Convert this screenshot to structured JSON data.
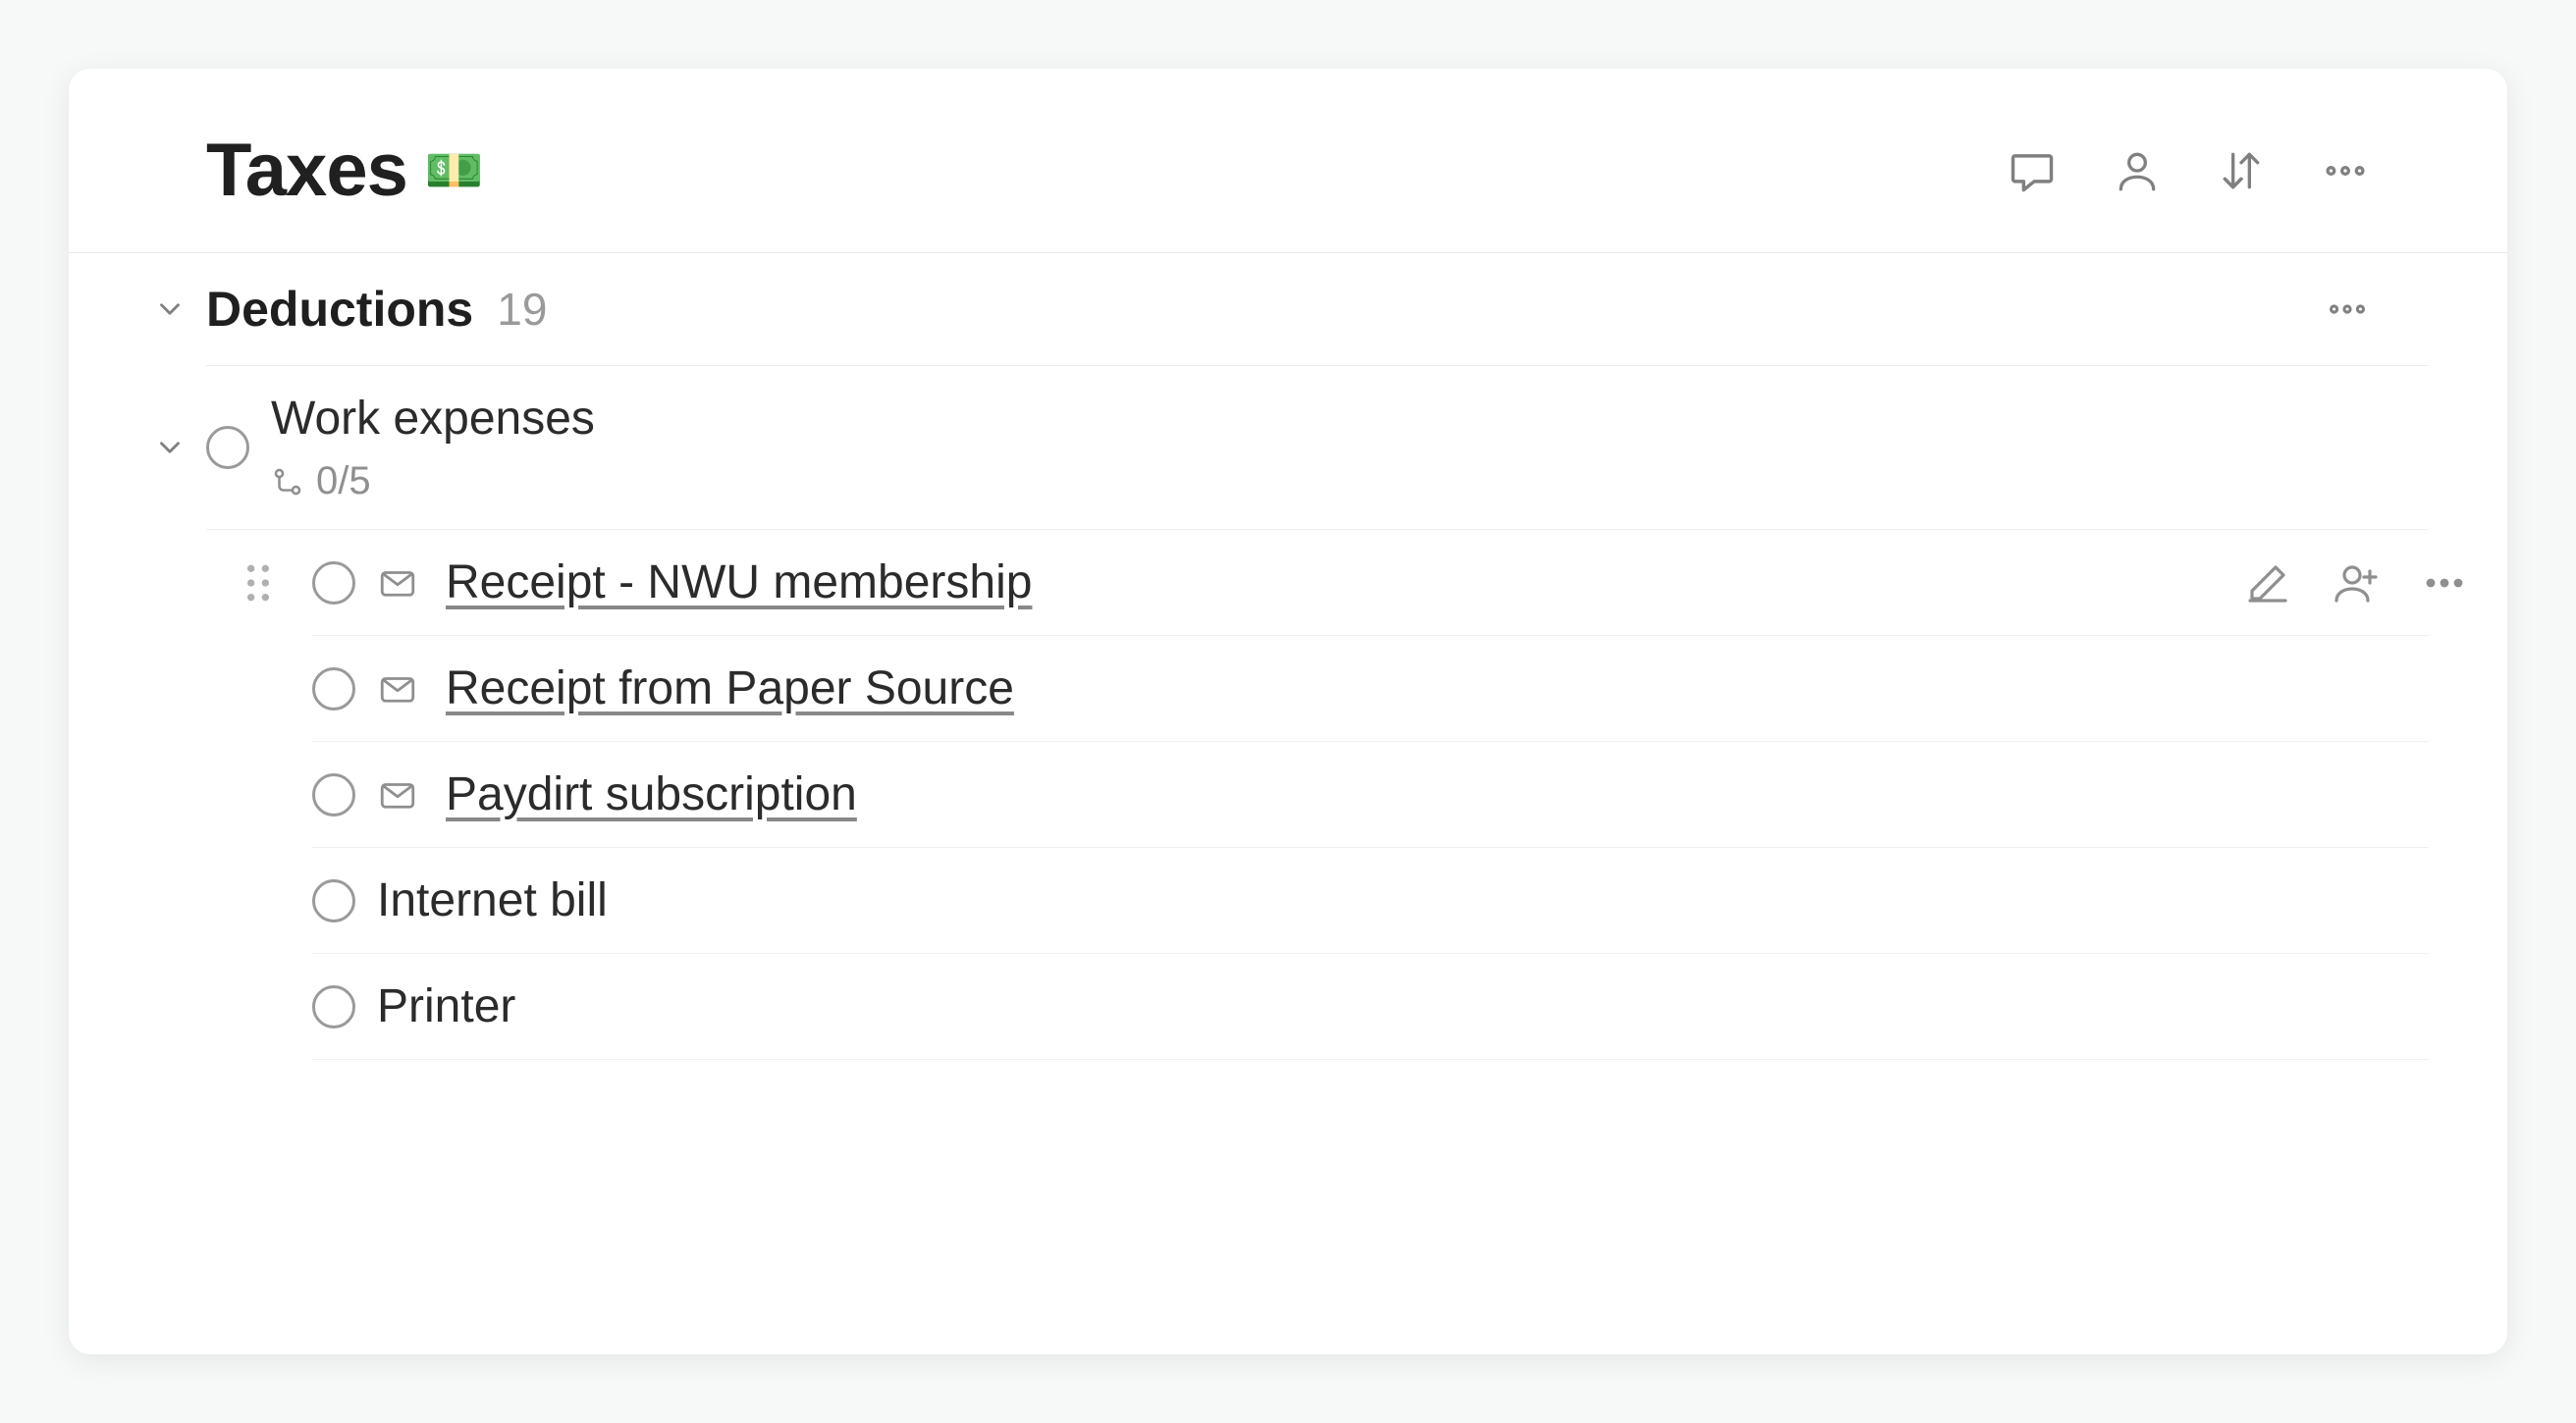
{
  "header": {
    "title": "Taxes",
    "emoji": "💵"
  },
  "section": {
    "title": "Deductions",
    "count": "19"
  },
  "parentTask": {
    "title": "Work expenses",
    "subtaskProgress": "0/5"
  },
  "subtasks": [
    {
      "title": "Receipt - NWU membership",
      "hasMail": true,
      "isLink": true,
      "hovered": true
    },
    {
      "title": "Receipt from Paper Source",
      "hasMail": true,
      "isLink": true,
      "hovered": false
    },
    {
      "title": "Paydirt subscription",
      "hasMail": true,
      "isLink": true,
      "hovered": false
    },
    {
      "title": "Internet bill",
      "hasMail": false,
      "isLink": false,
      "hovered": false
    },
    {
      "title": "Printer",
      "hasMail": false,
      "isLink": false,
      "hovered": false
    }
  ]
}
